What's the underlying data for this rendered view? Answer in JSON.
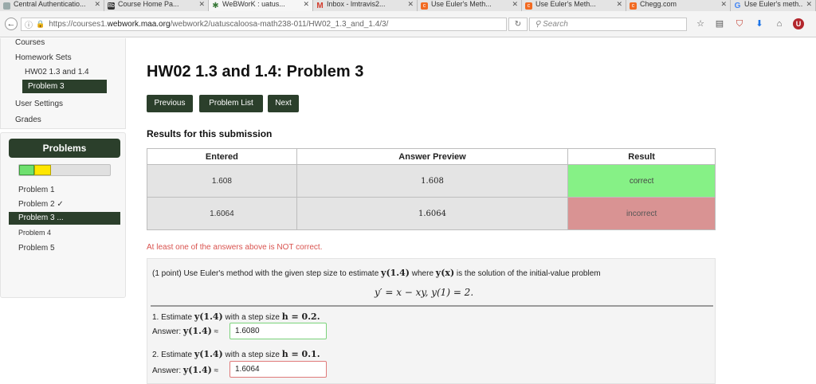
{
  "browser": {
    "tabs": [
      {
        "title": "Central Authenticatio...",
        "favicon": "page-icon",
        "active": false
      },
      {
        "title": "Course Home Pa...",
        "favicon": "blackboard-icon",
        "active": false
      },
      {
        "title": "WeBWorK : uatus...",
        "favicon": "webwork-icon",
        "active": true
      },
      {
        "title": "Inbox - lmtravis2...",
        "favicon": "gmail-icon",
        "active": false
      },
      {
        "title": "Use Euler's Meth...",
        "favicon": "chegg-icon",
        "active": false
      },
      {
        "title": "Use Euler's Meth...",
        "favicon": "chegg-icon",
        "active": false
      },
      {
        "title": "Chegg.com",
        "favicon": "chegg-icon",
        "active": false
      },
      {
        "title": "Use Euler's meth...",
        "favicon": "google-icon",
        "active": false
      }
    ],
    "url_prefix": "https://courses1.",
    "url_host": "webwork.maa.org",
    "url_path": "/webwork2/uatuscaloosa-math238-011/HW02_1.3_and_1.4/3/",
    "search_placeholder": "Search"
  },
  "sidebar": {
    "courses": "Courses",
    "homework_sets": "Homework Sets",
    "current_set": "HW02 1.3 and 1.4",
    "current_problem": "Problem 3",
    "user_settings": "User Settings",
    "grades": "Grades",
    "problems_header": "Problems",
    "progress": {
      "correct_fraction": 0.17,
      "partial_fraction": 0.18
    },
    "problems": [
      {
        "label": "Problem 1",
        "active": false
      },
      {
        "label": "Problem 2 ✓",
        "active": false
      },
      {
        "label": "Problem 3 ...",
        "active": true
      },
      {
        "label": "Problem 4",
        "active": false
      },
      {
        "label": "Problem 5",
        "active": false
      }
    ]
  },
  "main": {
    "title": "HW02 1.3 and 1.4: Problem 3",
    "buttons": {
      "previous": "Previous",
      "problem_list": "Problem List",
      "next": "Next"
    },
    "results_heading": "Results for this submission",
    "table": {
      "headers": [
        "Entered",
        "Answer Preview",
        "Result"
      ],
      "rows": [
        {
          "entered": "1.608",
          "preview": "1.608",
          "result": "correct"
        },
        {
          "entered": "1.6064",
          "preview": "1.6064",
          "result": "incorrect"
        }
      ]
    },
    "warning": "At least one of the answers above is NOT correct.",
    "problem": {
      "intro_1": "(1 point) Use Euler's method with the given step size to estimate ",
      "intro_y14": "y(1.4)",
      "intro_2": " where ",
      "intro_yx": "y(x)",
      "intro_3": " is the solution of the initial-value problem",
      "equation": "y′ = x − xy,    y(1) = 2.",
      "q1_prefix": "1. Estimate ",
      "q1_y": "y(1.4)",
      "q1_mid": " with a step size ",
      "q1_h": "h = 0.2.",
      "q2_prefix": "2. Estimate ",
      "q2_y": "y(1.4)",
      "q2_mid": " with a step size ",
      "q2_h": "h = 0.1.",
      "answer_label": "Answer: ",
      "answer_y": "y(1.4)",
      "approx": " ≈",
      "answer1": "1.6080",
      "answer2": "1.6064"
    }
  }
}
